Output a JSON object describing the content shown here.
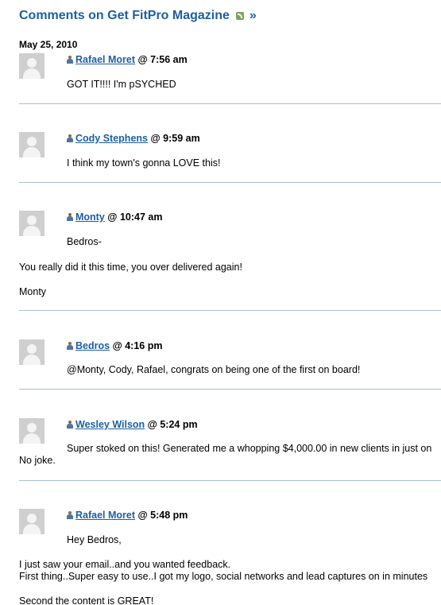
{
  "page": {
    "title": "Comments on Get FitPro Magazine",
    "feed_icon": "rss-feed-icon",
    "title_arrow": "»",
    "date": "May 25, 2010"
  },
  "comments": [
    {
      "author": "Rafael Moret",
      "time": "@ 7:56 am",
      "lines": [
        "GOT IT!!!! I'm pSYCHED"
      ]
    },
    {
      "author": "Cody Stephens",
      "time": "@ 9:59 am",
      "lines": [
        "I think my town's gonna LOVE this!"
      ]
    },
    {
      "author": "Monty",
      "time": "@ 10:47 am",
      "lines": [
        "Bedros-",
        "You really did it this time, you over delivered again!",
        "Monty"
      ]
    },
    {
      "author": "Bedros",
      "time": "@ 4:16 pm",
      "lines": [
        "@Monty, Cody, Rafael, congrats on being one of the first on board!"
      ]
    },
    {
      "author": "Wesley Wilson",
      "time": "@ 5:24 pm",
      "lines": [
        "Super stoked on this! Generated me a whopping $4,000.00 in new clients in just on",
        "No joke."
      ]
    },
    {
      "author": "Rafael Moret",
      "time": "@ 5:48 pm",
      "lines": [
        "Hey Bedros,",
        "I just saw your email..and you wanted feedback.",
        "First thing..Super easy to use..I got my logo, social networks and lead captures on in minutes",
        "Second the content is GREAT!"
      ]
    }
  ],
  "colors": {
    "link": "#1c5f9f",
    "separator": "#a9bfd4",
    "avatar": "#cfcfcf"
  },
  "icons": {
    "author": "user-icon",
    "avatar": "default-avatar"
  }
}
